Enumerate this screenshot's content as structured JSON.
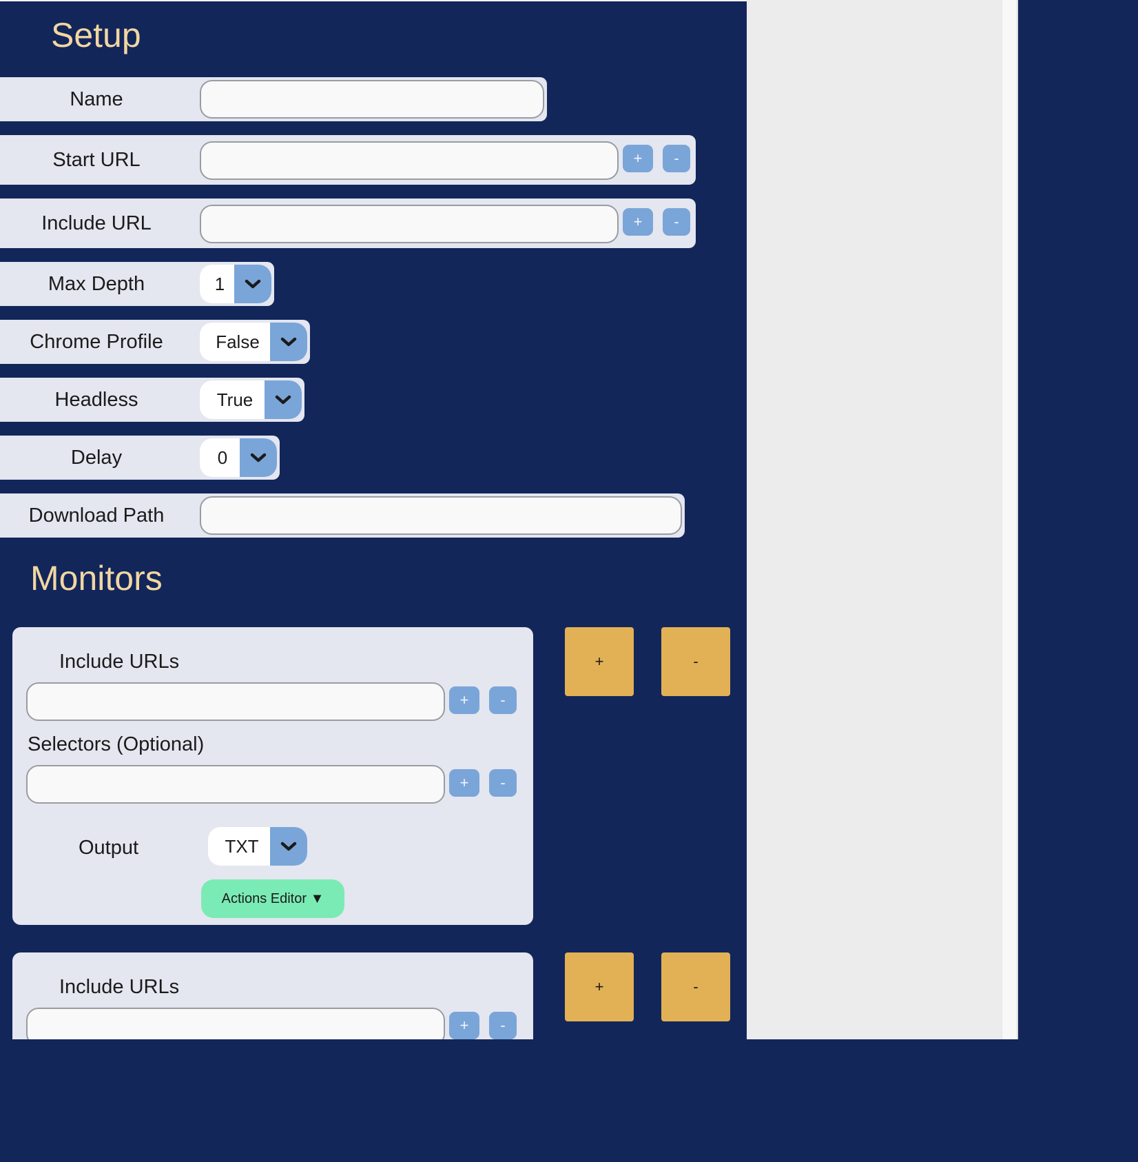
{
  "setup": {
    "title": "Setup",
    "fields": {
      "name": {
        "label": "Name",
        "value": ""
      },
      "start_url": {
        "label": "Start URL",
        "value": "",
        "add": "+",
        "remove": "-"
      },
      "include_url": {
        "label": "Include URL",
        "value": "",
        "add": "+",
        "remove": "-"
      },
      "max_depth": {
        "label": "Max Depth",
        "selected": "1"
      },
      "chrome_profile": {
        "label": "Chrome Profile",
        "selected": "False"
      },
      "headless": {
        "label": "Headless",
        "selected": "True"
      },
      "delay": {
        "label": "Delay",
        "selected": "0"
      },
      "download_path": {
        "label": "Download Path",
        "value": ""
      }
    }
  },
  "monitors": {
    "title": "Monitors",
    "add_monitor": "+",
    "remove_monitor": "-",
    "items": [
      {
        "include_urls_label": "Include URLs",
        "include_urls_value": "",
        "selectors_label": "Selectors (Optional)",
        "selectors_value": "",
        "add": "+",
        "remove": "-",
        "output_label": "Output",
        "output_selected": "TXT",
        "actions_editor": "Actions Editor ▼"
      },
      {
        "include_urls_label": "Include URLs",
        "include_urls_value": "",
        "add": "+",
        "remove": "-"
      }
    ]
  },
  "colors": {
    "background": "#12265a",
    "heading": "#f2d6a2",
    "row": "#e4e6f0",
    "small_button": "#7aa5d8",
    "monitor_button": "#e3b155",
    "actions_button": "#7bebb5"
  }
}
